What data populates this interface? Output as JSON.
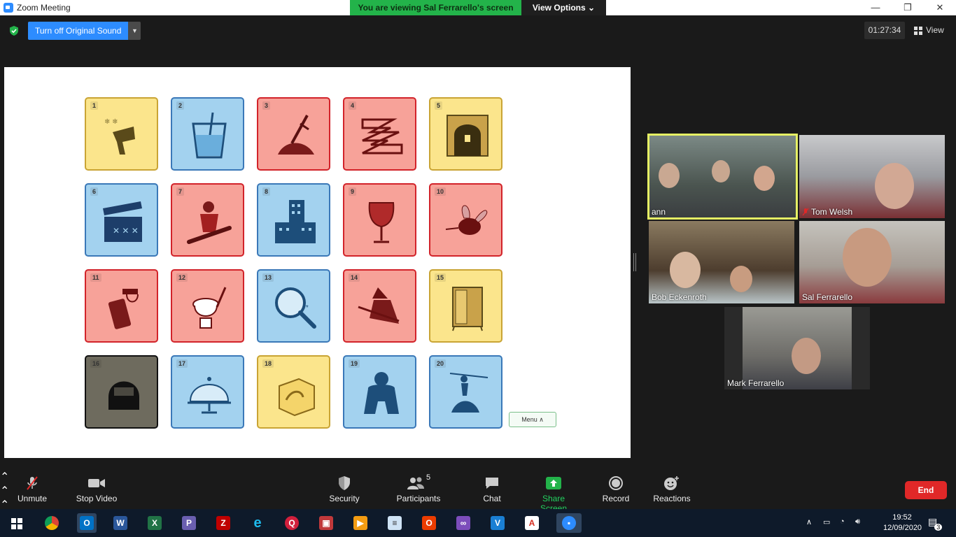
{
  "window": {
    "title": "Zoom Meeting",
    "controls": [
      "—",
      "❐",
      "✕"
    ]
  },
  "banner": {
    "viewing": "You are viewing Sal Ferrarello's screen",
    "view_options": "View Options"
  },
  "toolbar": {
    "original_sound": "Turn off Original Sound",
    "timer": "01:27:34",
    "view": "View"
  },
  "shared_screen": {
    "tiles": [
      {
        "n": "1",
        "color": "yellow",
        "icon": "hairdryer-snowflakes-icon"
      },
      {
        "n": "2",
        "color": "blue",
        "icon": "drink-glass-icon"
      },
      {
        "n": "3",
        "color": "red",
        "icon": "sword-in-hay-icon"
      },
      {
        "n": "4",
        "color": "red",
        "icon": "zigzag-maze-icon"
      },
      {
        "n": "5",
        "color": "yellow",
        "icon": "tunnel-icon"
      },
      {
        "n": "6",
        "color": "blue",
        "icon": "clapperboard-icon"
      },
      {
        "n": "7",
        "color": "red",
        "icon": "snowboarder-icon"
      },
      {
        "n": "8",
        "color": "blue",
        "icon": "buildings-icon"
      },
      {
        "n": "9",
        "color": "red",
        "icon": "wine-glass-icon"
      },
      {
        "n": "10",
        "color": "red",
        "icon": "bee-icon"
      },
      {
        "n": "11",
        "color": "red",
        "icon": "phone-icon"
      },
      {
        "n": "12",
        "color": "red",
        "icon": "toilet-plunger-icon"
      },
      {
        "n": "13",
        "color": "blue",
        "icon": "magnifier-icon"
      },
      {
        "n": "14",
        "color": "red",
        "icon": "witch-broom-icon"
      },
      {
        "n": "15",
        "color": "yellow",
        "icon": "wardrobe-icon"
      },
      {
        "n": "16",
        "color": "dark",
        "icon": "helmet-icon"
      },
      {
        "n": "17",
        "color": "blue",
        "icon": "cloche-icon"
      },
      {
        "n": "18",
        "color": "yellow",
        "icon": "ice-cube-icon"
      },
      {
        "n": "19",
        "color": "blue",
        "icon": "gorilla-icon"
      },
      {
        "n": "20",
        "color": "blue",
        "icon": "dancer-icon"
      }
    ],
    "menu_label": "Menu ∧"
  },
  "participants": [
    {
      "name": "ann"
    },
    {
      "name": "Tom Welsh"
    },
    {
      "name": "Bob Eckenroth"
    },
    {
      "name": "Sal Ferrarello"
    },
    {
      "name": "Mark Ferrarello"
    }
  ],
  "controls": {
    "unmute": "Unmute",
    "stop_video": "Stop Video",
    "security": "Security",
    "participants": "Participants",
    "participants_count": "5",
    "chat": "Chat",
    "share_screen": "Share Screen",
    "record": "Record",
    "reactions": "Reactions",
    "end": "End"
  },
  "taskbar": {
    "time": "19:52",
    "date": "12/09/2020",
    "notifications": "3",
    "apps": [
      "start",
      "chrome",
      "outlook",
      "word",
      "excel",
      "publisher",
      "filezilla",
      "ie",
      "quicken",
      "gallery",
      "vlc",
      "notepad",
      "office",
      "visual-studio",
      "vmware",
      "acrobat",
      "zoom"
    ]
  },
  "colors": {
    "accent": "#2d8cff",
    "share_green": "#23d160",
    "end_red": "#e02828"
  }
}
